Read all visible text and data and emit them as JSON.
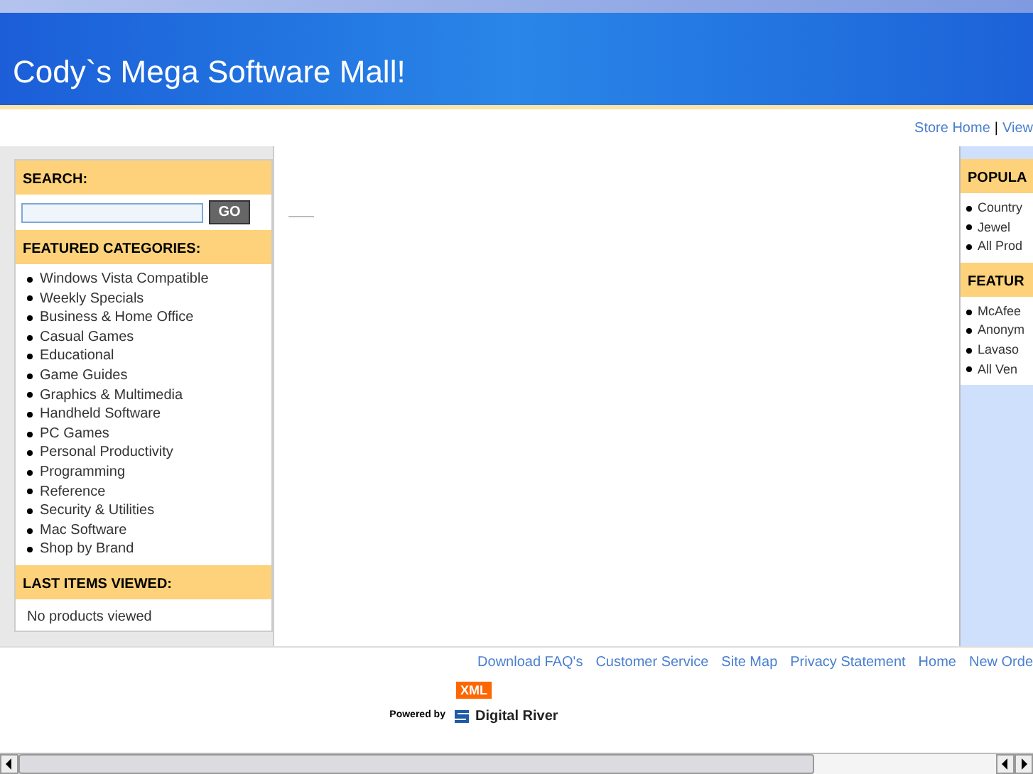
{
  "header": {
    "title": "Cody`s Mega Software Mall!"
  },
  "top_links": [
    "Store Home",
    "|",
    "View"
  ],
  "search": {
    "heading": "SEARCH:",
    "button": "GO"
  },
  "featured_categories": {
    "heading": "FEATURED CATEGORIES:",
    "items": [
      "Windows Vista Compatible",
      "Weekly Specials",
      "Business & Home Office",
      "Casual Games",
      "Educational",
      "Game Guides",
      "Graphics & Multimedia",
      "Handheld Software",
      "PC Games",
      "Personal Productivity",
      "Programming",
      "Reference",
      "Security & Utilities",
      "Mac Software",
      "Shop by Brand"
    ]
  },
  "last_items_viewed": {
    "heading": "LAST ITEMS VIEWED:",
    "text": "No products viewed"
  },
  "right_column": {
    "sections": [
      {
        "heading": "POPULA",
        "items": [
          "Country",
          "Jewel",
          "All Prod"
        ]
      },
      {
        "heading": "FEATUR",
        "items": [
          "McAfee",
          "Anonym",
          "Lavaso",
          "All Ven"
        ]
      }
    ]
  },
  "footer_links": [
    "Download FAQ's",
    "Customer Service",
    "Site Map",
    "Privacy Statement",
    "Home",
    "New Orde"
  ],
  "footer": {
    "badge": "XML",
    "powered_by": "Powered by",
    "brand": "Digital River"
  }
}
